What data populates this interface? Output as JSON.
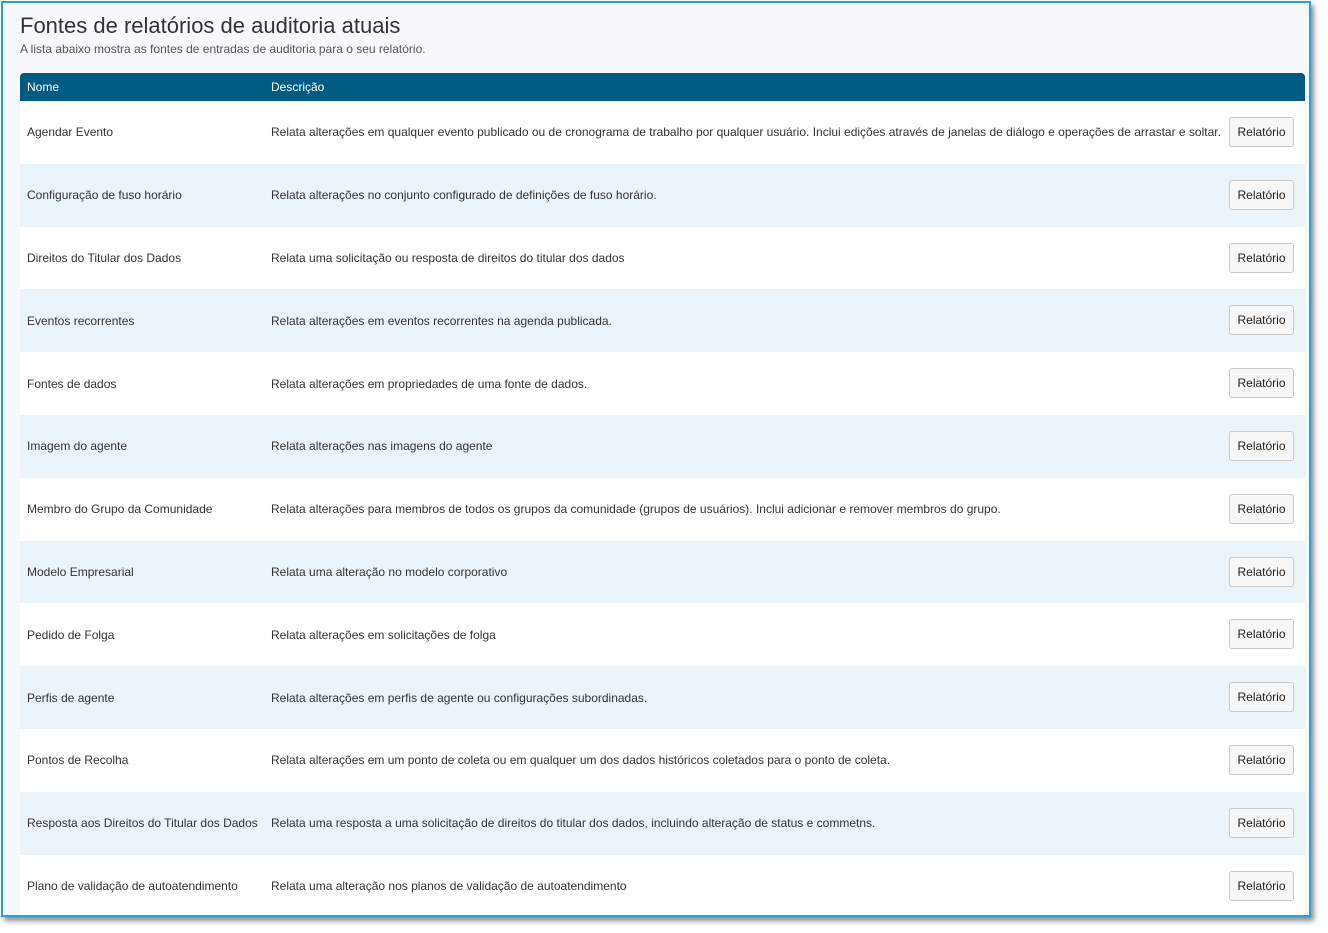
{
  "header": {
    "title": "Fontes de relatórios de auditoria atuais",
    "subtitle": "A lista abaixo mostra as fontes de entradas de auditoria para o seu relatório."
  },
  "table": {
    "columns": [
      "Nome",
      "Descrição"
    ],
    "button_label": "Relatório",
    "rows": [
      {
        "name": "Agendar Evento",
        "description": "Relata alterações em qualquer evento publicado ou de cronograma de trabalho por qualquer usuário. Inclui edições através de janelas de diálogo e operações de arrastar e soltar."
      },
      {
        "name": "Configuração de fuso horário",
        "description": "Relata alterações no conjunto configurado de definições de fuso horário."
      },
      {
        "name": "Direitos do Titular dos Dados",
        "description": "Relata uma solicitação ou resposta de direitos do titular dos dados"
      },
      {
        "name": "Eventos recorrentes",
        "description": "Relata alterações em eventos recorrentes na agenda publicada."
      },
      {
        "name": "Fontes de dados",
        "description": "Relata alterações em propriedades de uma fonte de dados."
      },
      {
        "name": "Imagem do agente",
        "description": "Relata alterações nas imagens do agente"
      },
      {
        "name": "Membro do Grupo da Comunidade",
        "description": "Relata alterações para membros de todos os grupos da comunidade (grupos de usuários). Inclui adicionar e remover membros do grupo."
      },
      {
        "name": "Modelo Empresarial",
        "description": "Relata uma alteração no modelo corporativo"
      },
      {
        "name": "Pedido de Folga",
        "description": "Relata alterações em solicitações de folga"
      },
      {
        "name": "Perfis de agente",
        "description": "Relata alterações em perfis de agente ou configurações subordinadas."
      },
      {
        "name": "Pontos de Recolha",
        "description": "Relata alterações em um ponto de coleta ou em qualquer um dos dados históricos coletados para o ponto de coleta."
      },
      {
        "name": "Resposta aos Direitos do Titular dos Dados",
        "description": "Relata uma resposta a uma solicitação de direitos do titular dos dados, incluindo alteração de status e commetns."
      },
      {
        "name": "Plano de validação de autoatendimento",
        "description": "Relata uma alteração nos planos de validação de autoatendimento"
      }
    ]
  },
  "colors": {
    "header_bg": "#005b82",
    "row_alt_bg": "#ebf3fb",
    "frame_border": "#2a9fd8"
  }
}
